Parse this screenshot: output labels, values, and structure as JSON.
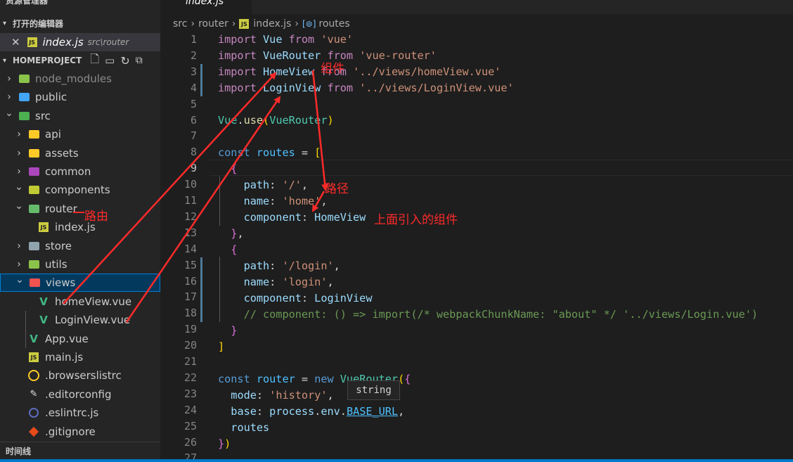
{
  "sidebar": {
    "explorer_title": "资源管理器",
    "open_editors": {
      "title": "打开的编辑器",
      "file": "index.js",
      "path": "src\\router"
    },
    "project": {
      "title": "HOMEPROJECT"
    },
    "tree": [
      {
        "label": "node_modules",
        "kind": "folder-node",
        "expanded": false,
        "dim": true
      },
      {
        "label": "public",
        "kind": "folder-public",
        "expanded": false
      },
      {
        "label": "src",
        "kind": "folder-src",
        "expanded": true
      },
      {
        "label": "api",
        "kind": "folder-api",
        "expanded": false
      },
      {
        "label": "assets",
        "kind": "folder-assets",
        "expanded": false
      },
      {
        "label": "common",
        "kind": "folder-common",
        "expanded": false
      },
      {
        "label": "components",
        "kind": "folder-components",
        "expanded": true
      },
      {
        "label": "router",
        "kind": "folder-router",
        "expanded": true
      },
      {
        "label": "index.js",
        "kind": "js"
      },
      {
        "label": "store",
        "kind": "folder-store",
        "expanded": false
      },
      {
        "label": "utils",
        "kind": "folder-utils",
        "expanded": false
      },
      {
        "label": "views",
        "kind": "folder-views",
        "expanded": true,
        "selected": true
      },
      {
        "label": "homeView.vue",
        "kind": "vue"
      },
      {
        "label": "LoginView.vue",
        "kind": "vue"
      },
      {
        "label": "App.vue",
        "kind": "vue"
      },
      {
        "label": "main.js",
        "kind": "js"
      },
      {
        "label": ".browserslistrc",
        "kind": "browserslist"
      },
      {
        "label": ".editorconfig",
        "kind": "editorconfig"
      },
      {
        "label": ".eslintrc.js",
        "kind": "eslint"
      },
      {
        "label": ".gitignore",
        "kind": "git"
      }
    ],
    "timeline_title": "时间线"
  },
  "editor": {
    "tab_label": "index.js",
    "breadcrumb": [
      "src",
      "router",
      "index.js",
      "routes"
    ],
    "hover_text": "string",
    "line_numbers": [
      "1",
      "2",
      "3",
      "4",
      "5",
      "6",
      "7",
      "8",
      "9",
      "10",
      "11",
      "12",
      "13",
      "14",
      "15",
      "16",
      "17",
      "18",
      "19",
      "20",
      "21",
      "22",
      "23",
      "24",
      "25",
      "26",
      "27"
    ],
    "current_line": "9"
  },
  "annotations": {
    "component": "组件",
    "path": "路径",
    "imported_component": "上面引入的组件",
    "route": "路由"
  },
  "colors": {
    "keyword": "#569cd6",
    "string": "#ce9178",
    "variable": "#9cdcfe",
    "comment": "#6a9955",
    "annotation": "#ff2a2a",
    "selection": "#04395e"
  }
}
